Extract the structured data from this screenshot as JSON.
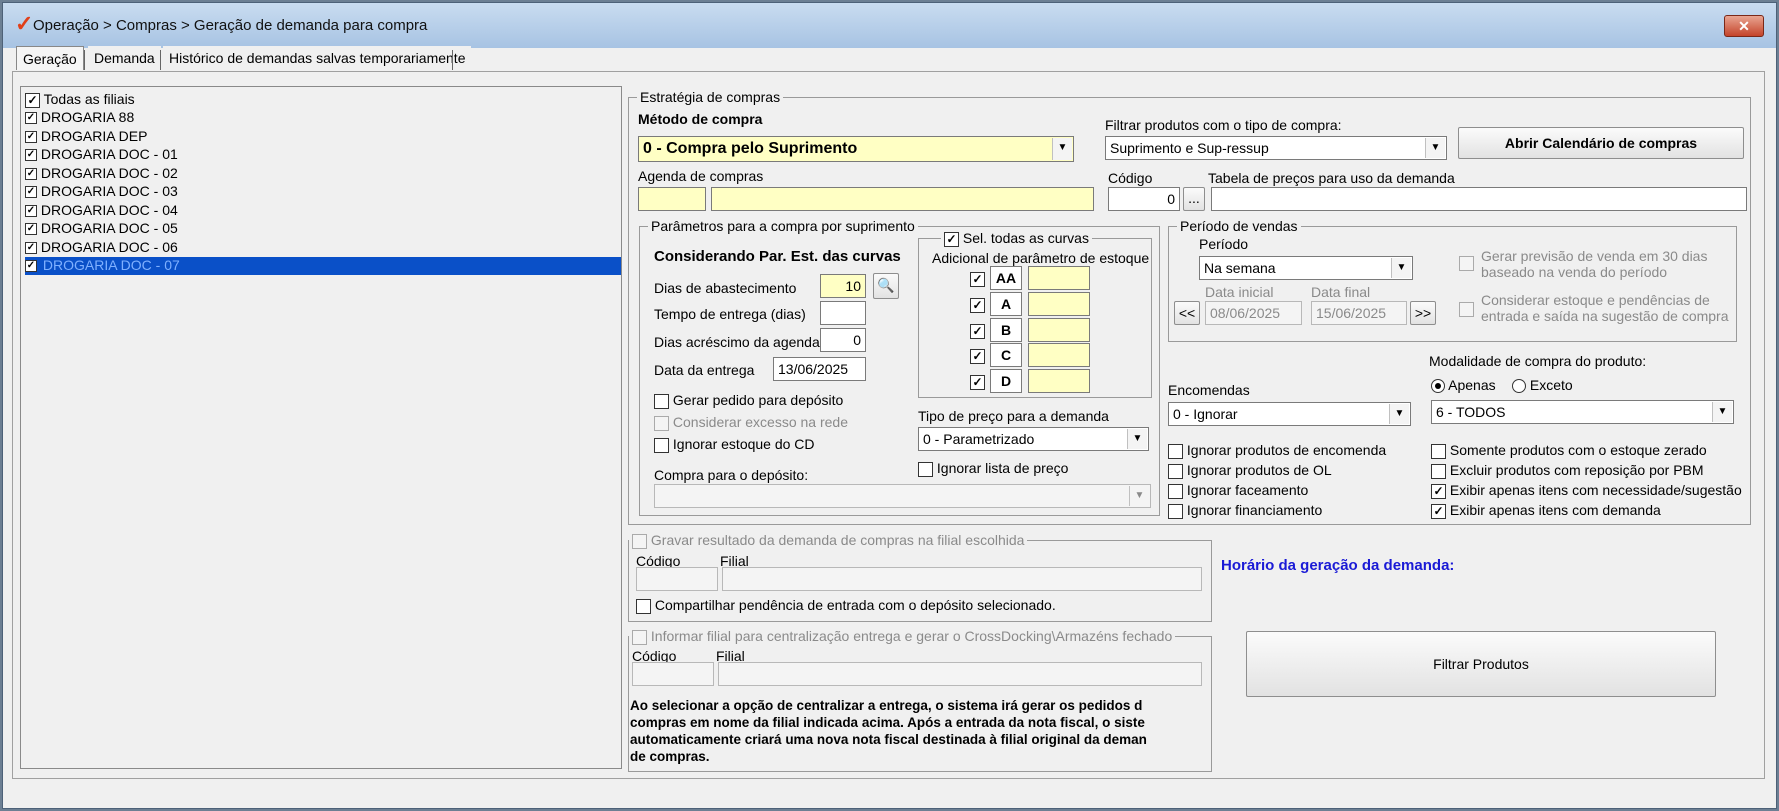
{
  "window": {
    "title": "Operação > Compras > Geração de demanda para compra",
    "close_label": "✕"
  },
  "tabs": [
    {
      "label": "Geração"
    },
    {
      "label": "Demanda"
    },
    {
      "label": "Histórico de demandas salvas temporariamente"
    }
  ],
  "filiais": {
    "todas_label": "Todas as filiais",
    "items": [
      {
        "label": "DROGARIA 88"
      },
      {
        "label": "DROGARIA DEP"
      },
      {
        "label": "DROGARIA DOC - 01"
      },
      {
        "label": "DROGARIA DOC - 02"
      },
      {
        "label": "DROGARIA DOC - 03"
      },
      {
        "label": "DROGARIA DOC - 04"
      },
      {
        "label": "DROGARIA DOC - 05"
      },
      {
        "label": "DROGARIA DOC - 06"
      },
      {
        "label": "DROGARIA DOC - 07"
      }
    ]
  },
  "estrategia": {
    "title": "Estratégia de compras",
    "metodo_label": "Método de compra",
    "metodo_value": "0 - Compra pelo Suprimento",
    "filtrar_label": "Filtrar produtos com o tipo de compra:",
    "filtrar_value": "Suprimento e Sup-ressup",
    "calendario_button": "Abrir Calendário de compras",
    "agenda_label": "Agenda de compras",
    "codigo_label": "Código",
    "codigo_value": "0",
    "ellipsis": "...",
    "tabela_label": "Tabela de preços para uso da demanda"
  },
  "parametros": {
    "title": "Parâmetros para a compra por suprimento",
    "considerando": "Considerando Par. Est. das curvas",
    "dias_abast_label": "Dias de abastecimento",
    "dias_abast_value": "10",
    "tempo_entrega_label": "Tempo de entrega (dias)",
    "dias_acresc_label": "Dias acréscimo da agenda",
    "dias_acresc_value": "0",
    "data_entrega_label": "Data da entrega",
    "data_entrega_value": "13/06/2025",
    "gerar_pedido": "Gerar pedido para depósito",
    "considerar_excesso": "Considerar excesso na rede",
    "ignorar_estoque_cd": "Ignorar estoque do CD",
    "compra_deposito_label": "Compra para o depósito:"
  },
  "curvas": {
    "sel_todas": "Sel. todas as curvas",
    "adicional": "Adicional de parâmetro de estoque",
    "items": [
      {
        "label": "AA"
      },
      {
        "label": "A"
      },
      {
        "label": "B"
      },
      {
        "label": "C"
      },
      {
        "label": "D"
      }
    ]
  },
  "tipo_preco": {
    "label": "Tipo de preço para a demanda",
    "value": "0 - Parametrizado",
    "ignorar_lista": "Ignorar lista de preço"
  },
  "periodo_vendas": {
    "title": "Período de vendas",
    "periodo_label": "Período",
    "periodo_value": "Na semana",
    "data_inicial_label": "Data inicial",
    "data_inicial_value": "08/06/2025",
    "data_final_label": "Data final",
    "data_final_value": "15/06/2025",
    "prev_label": "<<",
    "next_label": ">>",
    "gerar_previsao_1": "Gerar previsão de venda em 30 dias",
    "gerar_previsao_2": "baseado na venda do período",
    "considerar_estoque_1": "Considerar estoque e pendências de",
    "considerar_estoque_2": "entrada e saída  na sugestão de compra"
  },
  "modalidade": {
    "label": "Modalidade de compra do produto:",
    "apenas": "Apenas",
    "exceto": "Exceto",
    "value": "6 - TODOS"
  },
  "encomendas": {
    "label": "Encomendas",
    "value": "0 - Ignorar"
  },
  "opcoes_esq": [
    {
      "label": "Ignorar produtos de encomenda"
    },
    {
      "label": "Ignorar produtos de OL"
    },
    {
      "label": "Ignorar faceamento"
    },
    {
      "label": "Ignorar financiamento"
    }
  ],
  "opcoes_dir": [
    {
      "label": "Somente produtos com o estoque zerado",
      "checked": false
    },
    {
      "label": "Excluir produtos com reposição por PBM",
      "checked": false
    },
    {
      "label": "Exibir apenas itens com necessidade/sugestão",
      "checked": true
    },
    {
      "label": "Exibir apenas itens com demanda",
      "checked": true
    }
  ],
  "gravar": {
    "title": "Gravar resultado da demanda de compras na filial escolhida",
    "codigo_label": "Código",
    "filial_label": "Filial",
    "compartilhar": "Compartilhar pendência de entrada com o depósito selecionado."
  },
  "centralizar": {
    "title": "Informar filial para centralização entrega e gerar o CrossDocking\\Armazéns fechado",
    "codigo_label": "Código",
    "filial_label": "Filial",
    "aviso_1": "Ao selecionar a opção de centralizar a entrega, o sistema irá gerar os pedidos d",
    "aviso_2": "compras em nome da filial indicada acima. Após a entrada da nota fiscal, o siste",
    "aviso_3": "automaticamente criará uma nova nota fiscal destinada à filial original da deman",
    "aviso_4": "de compras."
  },
  "horario_label": "Horário da geração da demanda:",
  "filtrar_button": "Filtrar Produtos",
  "colors": {
    "accent": "#0a50c8",
    "yellow_field": "#ffffc4",
    "horario": "#1a1ad6"
  }
}
